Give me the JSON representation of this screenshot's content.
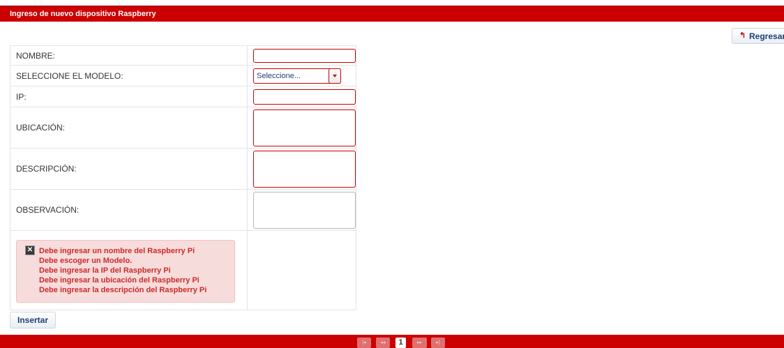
{
  "header": {
    "title": "Ingreso de nuevo dispositivo Raspberry"
  },
  "toolbar": {
    "back_label": "Regresar",
    "back_icon": "undo-arrow-icon"
  },
  "form": {
    "fields": [
      {
        "label": "NOMBRE:",
        "type": "text",
        "value": ""
      },
      {
        "label": "SELECCIONE EL MODELO:",
        "type": "select",
        "value": "Seleccione..."
      },
      {
        "label": "IP:",
        "type": "text",
        "value": ""
      },
      {
        "label": "UBICACIÓN:",
        "type": "textarea",
        "value": ""
      },
      {
        "label": "DESCRIPCIÓN:",
        "type": "textarea",
        "value": ""
      },
      {
        "label": "OBSERVACIÓN:",
        "type": "textarea",
        "value": ""
      }
    ],
    "errors": [
      "Debe ingresar un nombre del Raspberry Pi",
      "Debe escoger un Modelo.",
      "Debe ingresar la IP del Raspberry Pi",
      "Debe ingresar la ubicación del Raspberry Pi",
      "Debe ingresar la descripción del Raspberry Pi"
    ],
    "submit_label": "Insertar"
  },
  "pagination": {
    "first": "|◂",
    "prev": "◂◂",
    "current": "1",
    "next": "▸▸",
    "last": "▸|"
  },
  "colors": {
    "accent": "#cc0000",
    "error_text": "#cc2a2a",
    "error_bg": "#f7dcdc",
    "button_text": "#1f3f75"
  }
}
